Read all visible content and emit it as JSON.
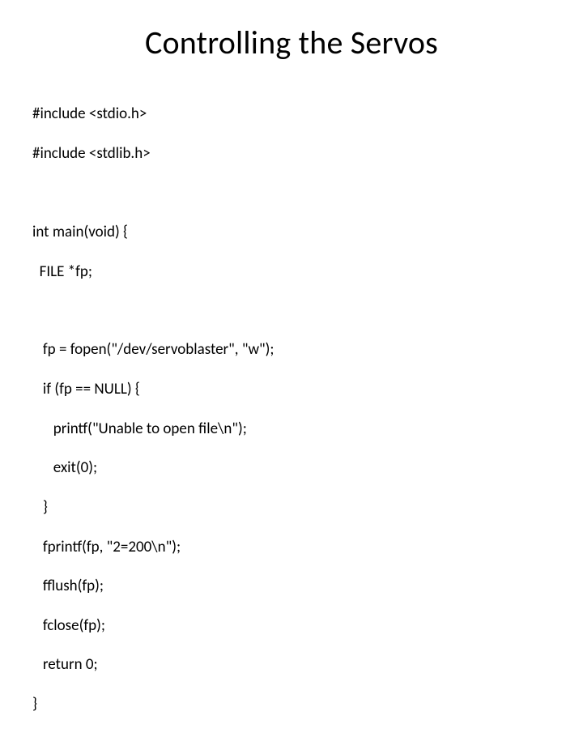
{
  "title": "Controlling the Servos",
  "code": {
    "l01": "#include <stdio.h>",
    "l02": "#include <stdlib.h>",
    "l03": "int main(void) {",
    "l04": "  FILE *fp;",
    "l05": "   fp = fopen(\"/dev/servoblaster\", \"w\");",
    "l06": "   if (fp == NULL) {",
    "l07": "      printf(\"Unable to open file\\n\");",
    "l08": "      exit(0);",
    "l09": "   }",
    "l10": "   fprintf(fp, \"2=200\\n\");",
    "l11": "   fflush(fp);",
    "l12": "   fclose(fp);",
    "l13": "   return 0;",
    "l14": "}"
  }
}
